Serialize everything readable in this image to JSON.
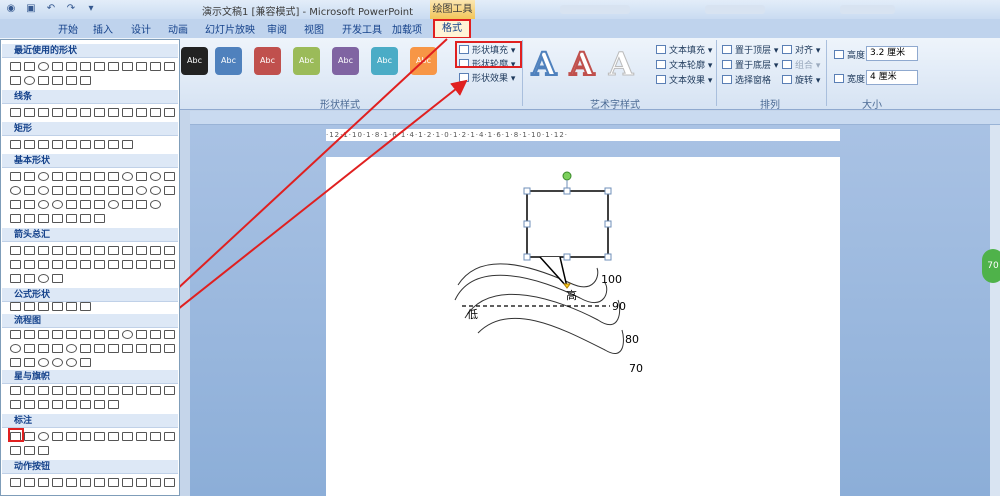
{
  "window": {
    "title": "演示文稿1 [兼容模式] - Microsoft PowerPoint",
    "context_title": "绘图工具"
  },
  "tabs": [
    "开始",
    "插入",
    "设计",
    "动画",
    "幻灯片放映",
    "审阅",
    "视图",
    "开发工具",
    "加载项"
  ],
  "active_tab": "格式",
  "ribbon": {
    "shape_styles": {
      "label": "形状样式",
      "style_text": "Abc",
      "colors": [
        "#222222",
        "#4f81bd",
        "#c0504d",
        "#9bbb59",
        "#8064a2",
        "#4bacc6",
        "#f79646"
      ],
      "fill": "形状填充",
      "outline": "形状轮廓",
      "effects": "形状效果"
    },
    "wordart": {
      "label": "艺术字样式",
      "fill": "文本填充",
      "outline": "文本轮廓",
      "effects": "文本效果"
    },
    "arrange": {
      "label": "排列",
      "bring_front": "置于顶层",
      "send_back": "置于底层",
      "selection_pane": "选择窗格",
      "align": "对齐",
      "group": "组合",
      "rotate": "旋转"
    },
    "size": {
      "label": "大小",
      "height_label": "高度:",
      "height_value": "3.2 厘米",
      "width_label": "宽度:",
      "width_value": "4 厘米"
    }
  },
  "shapes_panel": {
    "sections": [
      "最近使用的形状",
      "线条",
      "矩形",
      "基本形状",
      "箭头总汇",
      "公式形状",
      "流程图",
      "星与旗帜",
      "标注",
      "动作按钮"
    ]
  },
  "slide": {
    "contour_labels": [
      "100",
      "90",
      "80",
      "70"
    ],
    "high_label": "高",
    "low_label": "低"
  },
  "ruler_text": "·12·1·10·1·8·1·6·1·4·1·2·1·0·1·2·1·4·1·6·1·8·1·10·1·12·",
  "status": {
    "zoom_badge": "70"
  }
}
